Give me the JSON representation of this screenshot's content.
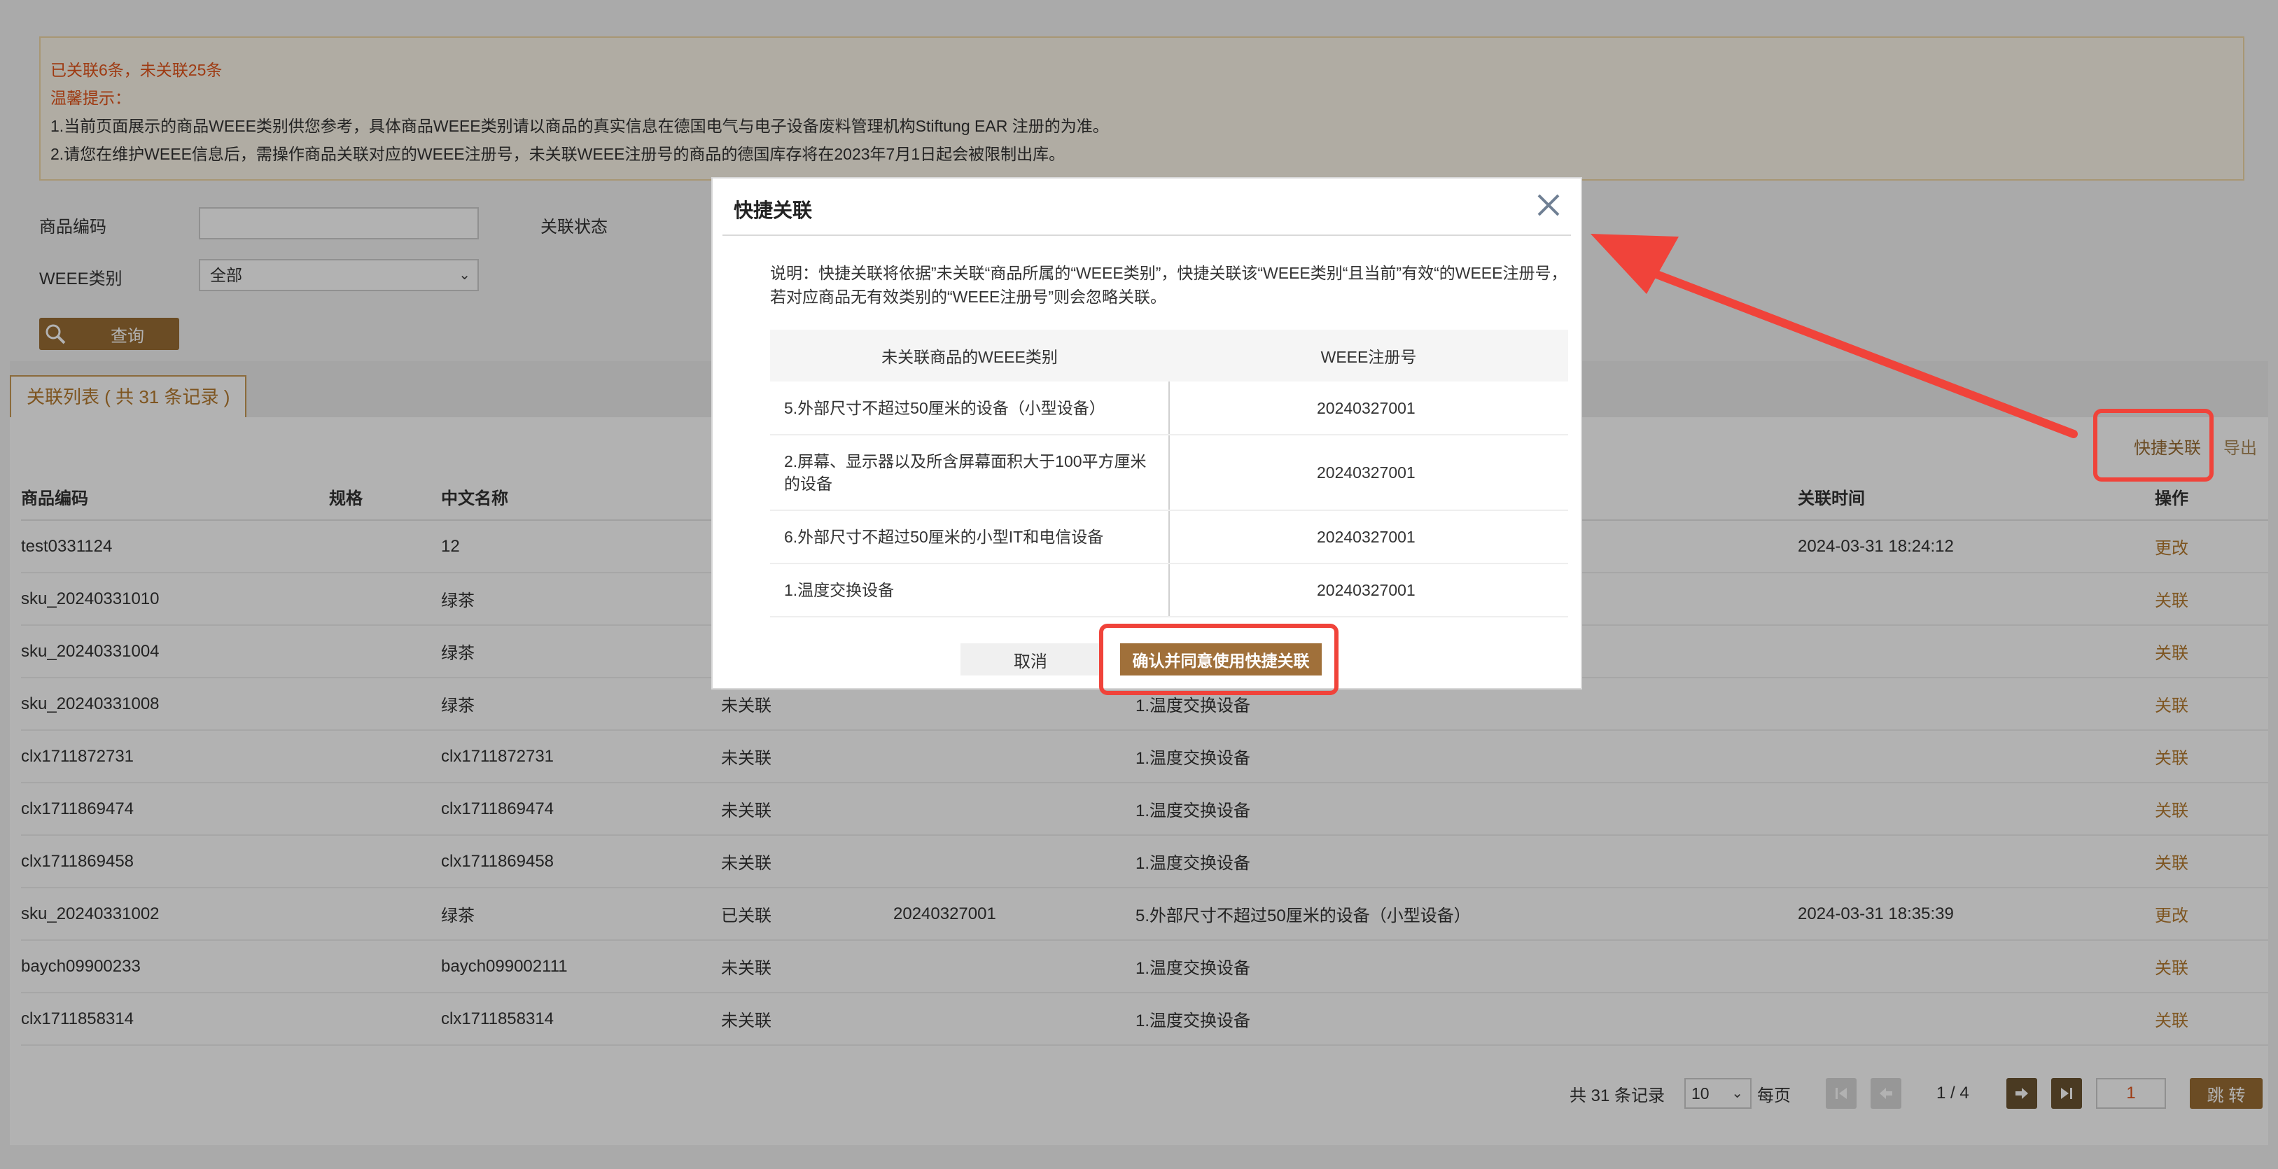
{
  "notice": {
    "summary": "已关联6条，未关联25条",
    "tip_title": "温馨提示：",
    "tip1": "1.当前页面展示的商品WEEE类别供您参考，具体商品WEEE类别请以商品的真实信息在德国电气与电子设备废料管理机构Stiftung EAR 注册的为准。",
    "tip2": "2.请您在维护WEEE信息后，需操作商品关联对应的WEEE注册号，未关联WEEE注册号的商品的德国库存将在2023年7月1日起会被限制出库。"
  },
  "filters": {
    "product_code_label": "商品编码",
    "link_status_label": "关联状态",
    "weee_category_label": "WEEE类别",
    "weee_category_value": "全部",
    "query_label": "查询"
  },
  "tab": {
    "label": "关联列表 ( 共 31 条记录 )"
  },
  "actions": {
    "quick_link": "快捷关联",
    "export": "导出"
  },
  "table": {
    "headers": [
      "商品编码",
      "规格",
      "中文名称",
      "",
      "",
      "",
      "关联时间",
      "操作"
    ],
    "rows": [
      [
        "test0331124",
        "",
        "12",
        "",
        "",
        "",
        "2024-03-31 18:24:12",
        "更改"
      ],
      [
        "sku_20240331010",
        "",
        "绿茶",
        "",
        "",
        "",
        "",
        "关联"
      ],
      [
        "sku_20240331004",
        "",
        "绿茶",
        "",
        "",
        "",
        "",
        "关联"
      ],
      [
        "sku_20240331008",
        "",
        "绿茶",
        "未关联",
        "",
        "1.温度交换设备",
        "",
        "关联"
      ],
      [
        "clx1711872731",
        "",
        "clx1711872731",
        "未关联",
        "",
        "1.温度交换设备",
        "",
        "关联"
      ],
      [
        "clx1711869474",
        "",
        "clx1711869474",
        "未关联",
        "",
        "1.温度交换设备",
        "",
        "关联"
      ],
      [
        "clx1711869458",
        "",
        "clx1711869458",
        "未关联",
        "",
        "1.温度交换设备",
        "",
        "关联"
      ],
      [
        "sku_20240331002",
        "",
        "绿茶",
        "已关联",
        "20240327001",
        "5.外部尺寸不超过50厘米的设备（小型设备）",
        "2024-03-31 18:35:39",
        "更改"
      ],
      [
        "baych09900233",
        "",
        "baych099002111",
        "未关联",
        "",
        "1.温度交换设备",
        "",
        "关联"
      ],
      [
        "clx1711858314",
        "",
        "clx1711858314",
        "未关联",
        "",
        "1.温度交换设备",
        "",
        "关联"
      ]
    ]
  },
  "pagination": {
    "total": "共 31 条记录",
    "page_size": "10",
    "per_page": "每页",
    "page_info": "1 / 4",
    "jump_value": "1",
    "jump_label": "跳 转"
  },
  "modal": {
    "title": "快捷关联",
    "description": "说明：快捷关联将依据”未关联“商品所属的“WEEE类别”，快捷关联该“WEEE类别“且当前”有效“的WEEE注册号，若对应商品无有效类别的“WEEE注册号”则会忽略关联。",
    "col1": "未关联商品的WEEE类别",
    "col2": "WEEE注册号",
    "rows": [
      [
        "5.外部尺寸不超过50厘米的设备（小型设备）",
        "20240327001"
      ],
      [
        "2.屏幕、显示器以及所含屏幕面积大于100平方厘米的设备",
        "20240327001"
      ],
      [
        "6.外部尺寸不超过50厘米的小型IT和电信设备",
        "20240327001"
      ],
      [
        "1.温度交换设备",
        "20240327001"
      ]
    ],
    "cancel": "取消",
    "confirm": "确认并同意使用快捷关联"
  },
  "colors": {
    "accent": "#9a6d34",
    "highlight": "#f0433a",
    "notice_text": "#e2541a"
  }
}
